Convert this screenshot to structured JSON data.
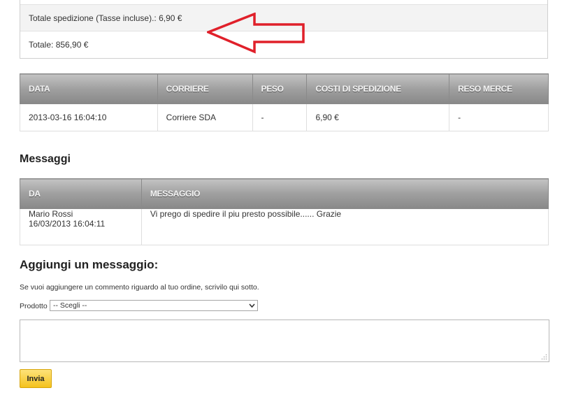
{
  "totals": {
    "shipping": "Totale spedizione (Tasse incluse).: 6,90 €",
    "total": "Totale: 856,90 €"
  },
  "shipping_table": {
    "headers": [
      "DATA",
      "CORRIERE",
      "PESO",
      "COSTI DI SPEDIZIONE",
      "RESO MERCE"
    ],
    "rows": [
      [
        "2013-03-16 16:04:10",
        "Corriere SDA",
        "-",
        "6,90 €",
        "-"
      ]
    ]
  },
  "messages": {
    "title": "Messaggi",
    "headers": [
      "DA",
      "MESSAGGIO"
    ],
    "rows": [
      {
        "from_name": "Mario Rossi",
        "from_date": "16/03/2013 16:04:11",
        "text": "Vi prego di spedire il piu presto possibile...... Grazie"
      }
    ]
  },
  "add_message": {
    "title": "Aggiungi un messaggio:",
    "hint": "Se vuoi aggiungere un commento riguardo al tuo ordine, scrivilo qui sotto.",
    "product_label": "Prodotto",
    "product_selected": "-- Scegli --",
    "textarea_value": "",
    "submit_label": "Invia"
  },
  "colors": {
    "annotation_arrow": "#e0202a",
    "button": "#f4c21d",
    "header_bg": "#a0a0a0"
  },
  "icons": [
    "red-arrow-annotation",
    "chevron-down-icon",
    "resize-grip-icon"
  ]
}
